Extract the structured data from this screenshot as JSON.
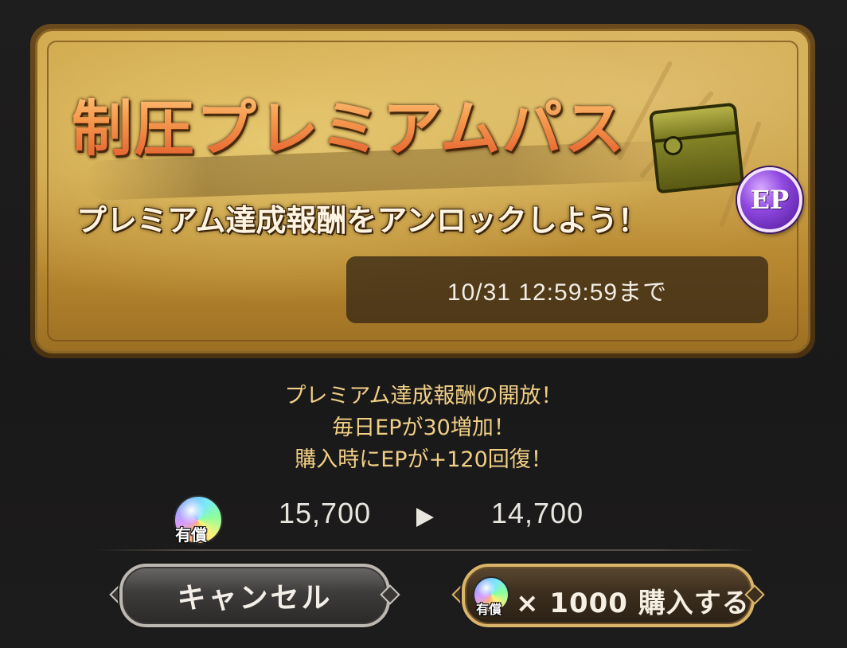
{
  "banner": {
    "title": "制圧プレミアムパス",
    "subtitle": "プレミアム達成報酬をアンロックしよう！",
    "badge": "EP",
    "deadline": "10/31 12:59:59まで"
  },
  "description": [
    "プレミアム達成報酬の開放！",
    "毎日EPが30増加！",
    "購入時にEPが+120回復！"
  ],
  "price": {
    "currency_label": "有償",
    "current": "15,700",
    "after": "14,700"
  },
  "buttons": {
    "cancel_label": "キャンセル",
    "buy_currency_label": "有償",
    "buy_label": "× 1000 購入する"
  },
  "colors": {
    "accent_text": "#f0cf85",
    "ep_badge": "#8f48e0",
    "buy_border": "#d9b46a"
  },
  "icons": [
    "treasure-chest-icon",
    "ep-badge-icon",
    "paid-gem-icon",
    "arrow-right-icon"
  ]
}
